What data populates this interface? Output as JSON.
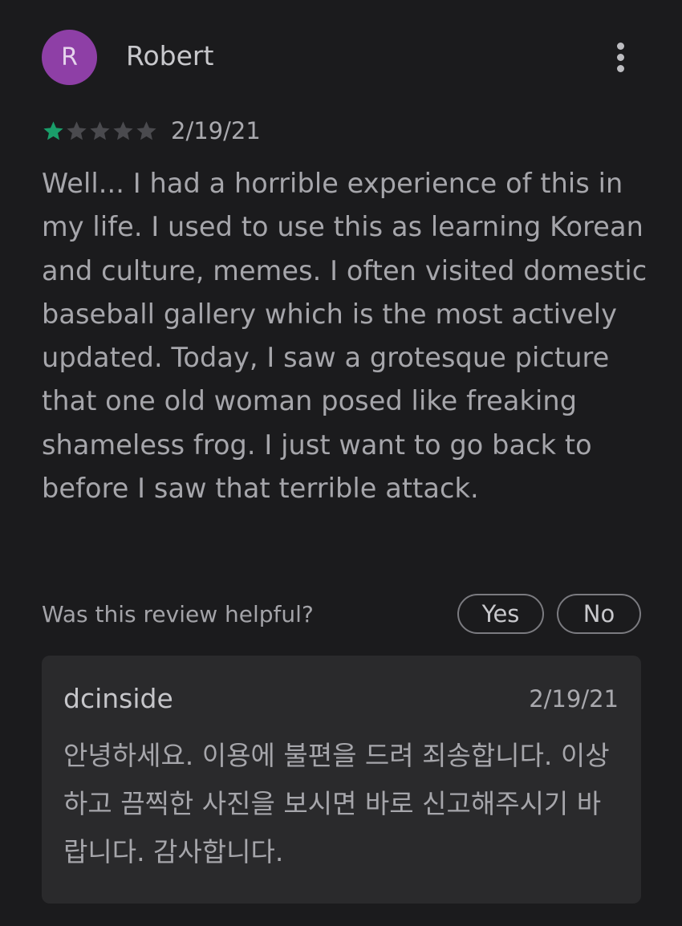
{
  "review": {
    "avatar_initial": "R",
    "avatar_color": "#8e3fa6",
    "author": "Robert",
    "menu_icon": "more-vert-icon",
    "rating": 1,
    "rating_max": 5,
    "star_filled_color": "#1a9e6a",
    "star_empty_color": "#4a4a4e",
    "date": "2/19/21",
    "text": "Well... I had a horrible experience of this in my life. I used to use this as learning Korean and culture, memes. I often visited domestic baseball gallery which is the most actively updated. Today, I saw a grotesque picture that one old woman posed like freaking shameless frog. I just want to go back to before I saw that terrible attack."
  },
  "helpful": {
    "question": "Was this review helpful?",
    "yes_label": "Yes",
    "no_label": "No"
  },
  "developer_reply": {
    "author": "dcinside",
    "date": "2/19/21",
    "text": "안녕하세요. 이용에 불편을 드려 죄송합니다. 이상하고 끔찍한 사진을 보시면 바로 신고해주시기 바랍니다. 감사합니다."
  }
}
